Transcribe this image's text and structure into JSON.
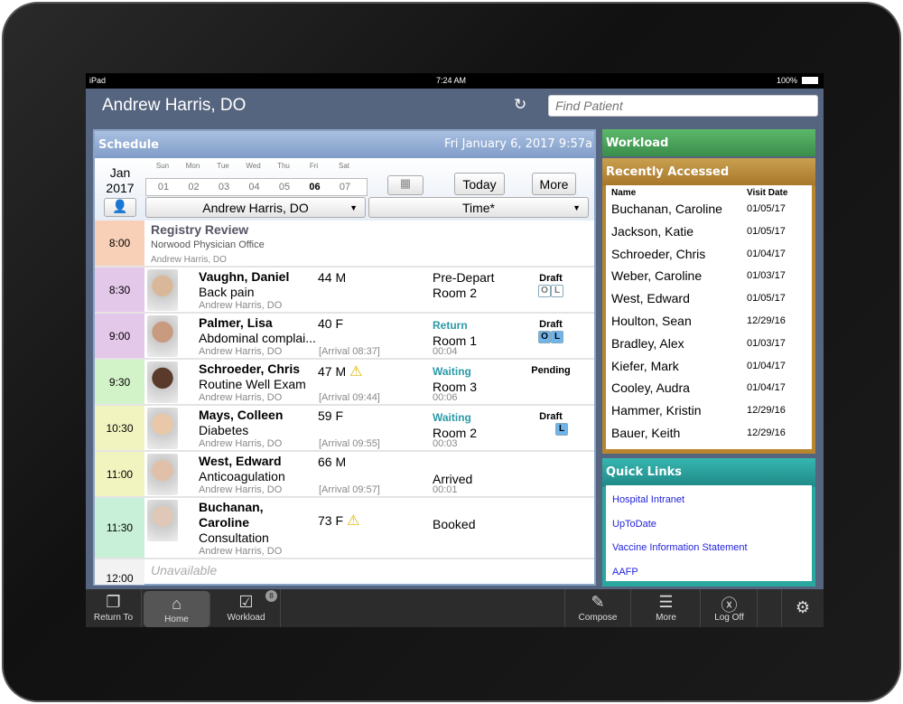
{
  "status": {
    "device": "iPad",
    "time": "7:24 AM",
    "battery": "100%"
  },
  "header": {
    "title": "Andrew Harris, DO",
    "search_placeholder": "Find Patient"
  },
  "schedule": {
    "title": "Schedule",
    "datetime": "Fri January 6, 2017 9:57a",
    "month": "Jan",
    "year": "2017",
    "dows": [
      "Sun",
      "Mon",
      "Tue",
      "Wed",
      "Thu",
      "Fri",
      "Sat"
    ],
    "days": [
      "01",
      "02",
      "03",
      "04",
      "05",
      "06",
      "07"
    ],
    "selected_day": "06",
    "today_label": "Today",
    "more_label": "More",
    "provider_select": "Andrew Harris, DO",
    "sort_select": "Time*",
    "event": {
      "time": "8:00",
      "title": "Registry Review",
      "location": "Norwood Physician Office",
      "provider": "Andrew Harris, DO",
      "color": "#f8d0b8"
    },
    "appointments": [
      {
        "time": "8:30",
        "name": "Vaughn, Daniel",
        "reason": "Back pain",
        "provider": "Andrew Harris, DO",
        "age": "44 M",
        "warning": false,
        "arrival": "",
        "status": "Pre-Depart",
        "room": "Room 2",
        "elapsed": "",
        "note": "Draft",
        "tags": [
          [
            "O",
            false
          ],
          [
            "L",
            false
          ]
        ],
        "color": "#e4c8ea"
      },
      {
        "time": "9:00",
        "name": "Palmer, Lisa",
        "reason": "Abdominal complai...",
        "provider": "Andrew Harris, DO",
        "age": "40 F",
        "warning": false,
        "arrival": "[Arrival 08:37]",
        "status": "Return",
        "room": "Room 1",
        "elapsed": "00:04",
        "note": "Draft",
        "tags": [
          [
            "O",
            true
          ],
          [
            "L",
            true
          ]
        ],
        "color": "#e4c8ea"
      },
      {
        "time": "9:30",
        "name": "Schroeder, Chris",
        "reason": "Routine Well Exam",
        "provider": "Andrew Harris, DO",
        "age": "47 M",
        "warning": true,
        "arrival": "[Arrival 09:44]",
        "status": "Waiting",
        "room": "Room 3",
        "elapsed": "00:06",
        "note": "Pending",
        "tags": [],
        "color": "#d2f2c8"
      },
      {
        "time": "10:30",
        "name": "Mays, Colleen",
        "reason": "Diabetes",
        "provider": "Andrew Harris, DO",
        "age": "59 F",
        "warning": false,
        "arrival": "[Arrival 09:55]",
        "status": "Waiting",
        "room": "Room 2",
        "elapsed": "00:03",
        "note": "Draft",
        "tags": [
          [
            "L",
            true
          ]
        ],
        "color": "#f2f4c0"
      },
      {
        "time": "11:00",
        "name": "West, Edward",
        "reason": "Anticoagulation",
        "provider": "Andrew Harris, DO",
        "age": "66 M",
        "warning": false,
        "arrival": "[Arrival 09:57]",
        "status": "",
        "room": "Arrived",
        "elapsed": "00:01",
        "note": "",
        "tags": [],
        "color": "#f2f4c0"
      },
      {
        "time": "11:30",
        "name": "Buchanan, Caroline",
        "reason": "Consultation",
        "provider": "Andrew Harris, DO",
        "age": "73 F",
        "warning": true,
        "arrival": "",
        "status": "",
        "room": "Booked",
        "elapsed": "",
        "note": "",
        "tags": [],
        "color": "#c8f0d8"
      }
    ],
    "unavailable": {
      "time": "12:00",
      "label": "Unavailable"
    }
  },
  "workload": {
    "title": "Workload"
  },
  "recent": {
    "title": "Recently Accessed",
    "col_name": "Name",
    "col_date": "Visit Date",
    "items": [
      [
        "Buchanan, Caroline",
        "01/05/17"
      ],
      [
        "Jackson, Katie",
        "01/05/17"
      ],
      [
        "Schroeder, Chris",
        "01/04/17"
      ],
      [
        "Weber, Caroline",
        "01/03/17"
      ],
      [
        "West, Edward",
        "01/05/17"
      ],
      [
        "Houlton, Sean",
        "12/29/16"
      ],
      [
        "Bradley, Alex",
        "01/03/17"
      ],
      [
        "Kiefer, Mark",
        "01/04/17"
      ],
      [
        "Cooley, Audra",
        "01/04/17"
      ],
      [
        "Hammer, Kristin",
        "12/29/16"
      ],
      [
        "Bauer, Keith",
        "12/29/16"
      ]
    ]
  },
  "quick_links": {
    "title": "Quick Links",
    "items": [
      "Hospital Intranet",
      "UpToDate",
      "Vaccine Information Statement",
      "AAFP"
    ]
  },
  "toolbar": {
    "return_to": "Return To",
    "home": "Home",
    "workload": "Workload",
    "workload_badge": "8",
    "compose": "Compose",
    "more": "More",
    "log_off": "Log Off"
  },
  "colors": {
    "header": "#56657f",
    "workload": "#4aa25a",
    "recent": "#b8862e",
    "quick_links": "#2aa8a0",
    "status_teal": "#2a9aa8"
  }
}
